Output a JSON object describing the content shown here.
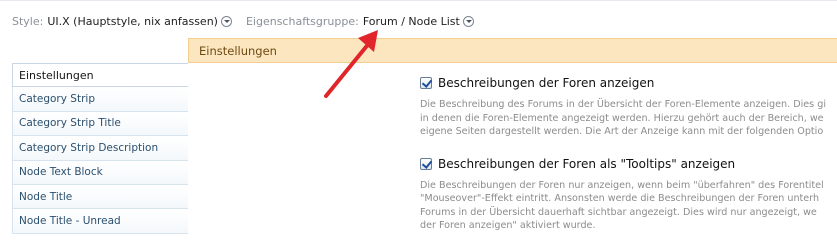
{
  "selector": {
    "style_label": "Style:",
    "style_value": "UI.X (Hauptstyle, nix anfassen)",
    "group_label": "Eigenschaftsgruppe:",
    "group_value": "Forum / Node List"
  },
  "heading": "Einstellungen",
  "sidebar": {
    "items": [
      {
        "label": "Einstellungen"
      },
      {
        "label": "Category Strip"
      },
      {
        "label": "Category Strip Title"
      },
      {
        "label": "Category Strip Description"
      },
      {
        "label": "Node Text Block"
      },
      {
        "label": "Node Title"
      },
      {
        "label": "Node Title - Unread"
      }
    ]
  },
  "options": [
    {
      "label": "Beschreibungen der Foren anzeigen",
      "checked": true,
      "description": [
        "Die Beschreibung des Forums in der Übersicht der Foren-Elemente anzeigen. Dies gi",
        "in denen die Foren-Elemente angezeigt werden. Hierzu gehört auch der Bereich, we",
        "eigene Seiten dargestellt werden. Die Art der Anzeige kann mit der folgenden Optio"
      ]
    },
    {
      "label": "Beschreibungen der Foren als \"Tooltips\" anzeigen",
      "checked": true,
      "description": [
        "Die Beschreibungen der Foren nur anzeigen, wenn beim \"überfahren\" des Forentitel",
        "\"Mouseover\"-Effekt eintritt. Ansonsten werde die Beschreibungen der Foren unterh",
        "Forums in der Übersicht dauerhaft sichtbar angezeigt. Dies wird nur angezeigt, we",
        "der Foren anzeigen\" aktiviert wurde."
      ]
    }
  ],
  "colors": {
    "accent_arrow": "#e0262b",
    "heading_bg": "#fbe6bf",
    "link": "#2a4f6f"
  }
}
